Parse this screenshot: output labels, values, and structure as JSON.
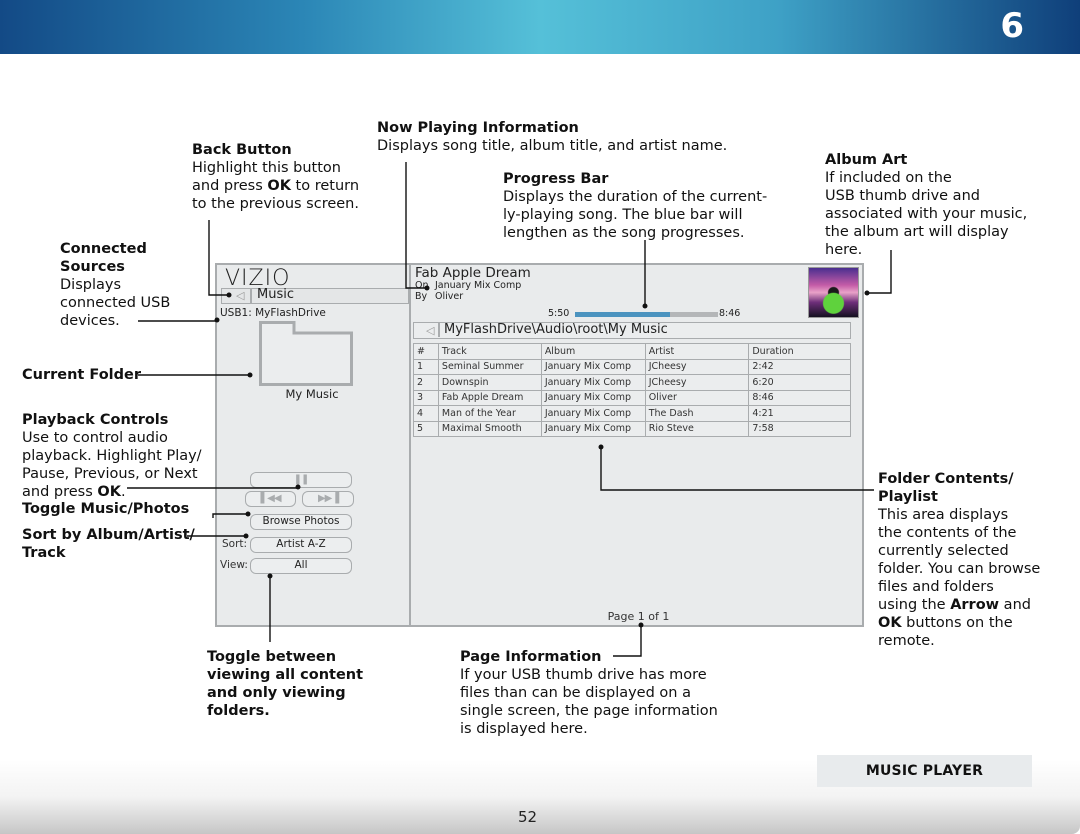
{
  "header": {
    "chapter_number": "6"
  },
  "footer": {
    "section_label": "MUSIC PLAYER",
    "page_number": "52"
  },
  "callouts": {
    "back_button": {
      "title": "Back Button",
      "body_lines": [
        "Highlight this button",
        "and press ",
        "OK",
        " to return",
        "to the previous screen."
      ]
    },
    "now_playing": {
      "title": "Now Playing Information",
      "body": "Displays song title, album title, and artist name."
    },
    "progress_bar": {
      "title": "Progress Bar",
      "body_lines": [
        "Displays the duration of the current-",
        "ly-playing song. The blue bar will",
        "lengthen as the song progresses."
      ]
    },
    "album_art": {
      "title": "Album Art",
      "body_lines": [
        "If included on the",
        "USB thumb drive and",
        "associated with your music,",
        "the album art will display",
        "here."
      ]
    },
    "connected_sources": {
      "title_lines": [
        "Connected",
        "Sources"
      ],
      "body_lines": [
        "Displays",
        "connected USB",
        "devices."
      ]
    },
    "current_folder": {
      "title": "Current Folder"
    },
    "playback_controls": {
      "title": "Playback Controls",
      "body_lines": [
        "Use to control audio",
        "playback. Highlight Play/",
        "Pause, Previous, or Next",
        "and press ",
        "OK",
        "."
      ]
    },
    "toggle_music_photos": {
      "title": "Toggle Music/Photos"
    },
    "sort": {
      "title_lines": [
        "Sort by Album/Artist/",
        "Track"
      ]
    },
    "view_toggle": {
      "title_lines": [
        "Toggle between",
        "viewing all content",
        "and only viewing",
        "folders."
      ]
    },
    "page_information": {
      "title": "Page Information",
      "body_lines": [
        "If your USB thumb drive has more",
        "files than can be displayed on a",
        "single screen, the page information",
        "is displayed here."
      ]
    },
    "folder_contents": {
      "title_lines": [
        "Folder Contents/",
        "Playlist"
      ],
      "body_lines": [
        "This area displays",
        "the contents of the",
        "currently selected",
        "folder. You can browse",
        "files and folders",
        "using the ",
        "Arrow",
        " and",
        "OK",
        " buttons on the",
        "remote."
      ]
    }
  },
  "tv_ui": {
    "logo": "VIZIO",
    "back_label": "Music",
    "source": "USB1: MyFlashDrive",
    "current_folder": "My Music",
    "controls": {
      "play_pause_icon": "pause-icon",
      "previous_icon": "previous-icon",
      "next_icon": "next-icon",
      "toggle_label": "Browse Photos",
      "sort_label": "Sort:",
      "sort_value": "Artist A-Z",
      "view_label": "View:",
      "view_value": "All"
    },
    "now_playing": {
      "title": "Fab Apple Dream",
      "album_key": "On",
      "album": "January Mix Comp",
      "artist_key": "By",
      "artist": "Oliver",
      "elapsed": "5:50",
      "total": "8:46",
      "progress_fraction": 0.665
    },
    "path": "MyFlashDrive\\Audio\\root\\My Music",
    "table": {
      "columns": [
        "#",
        "Track",
        "Album",
        "Artist",
        "Duration"
      ],
      "rows": [
        [
          "1",
          "Seminal Summer",
          "January Mix Comp",
          "JCheesy",
          "2:42"
        ],
        [
          "2",
          "Downspin",
          "January Mix Comp",
          "JCheesy",
          "6:20"
        ],
        [
          "3",
          "Fab Apple Dream",
          "January Mix Comp",
          "Oliver",
          "8:46"
        ],
        [
          "4",
          "Man of the Year",
          "January Mix Comp",
          "The Dash",
          "4:21"
        ],
        [
          "5",
          "Maximal Smooth",
          "January Mix Comp",
          "Rio Steve",
          "7:58"
        ]
      ]
    },
    "page_info": "Page 1 of 1"
  },
  "colors": {
    "progress_fill": "#4b93bf",
    "progress_track": "#b4b6b8",
    "panel_bg": "#e9ebec"
  }
}
